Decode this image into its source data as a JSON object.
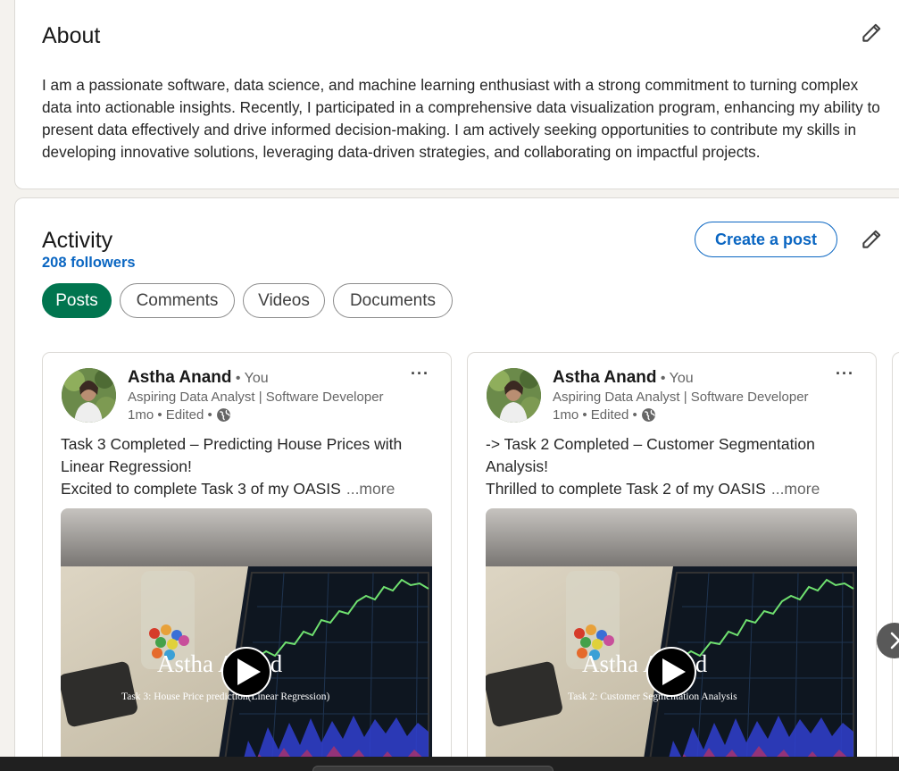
{
  "about": {
    "title": "About",
    "text": "I am a passionate software, data science, and machine learning enthusiast with a strong commitment to turning complex data into actionable insights. Recently, I participated in a comprehensive data visualization program, enhancing my ability to present data effectively and drive informed decision-making. I am actively seeking opportunities to contribute my skills in developing innovative solutions, leveraging data-driven strategies, and collaborating on impactful projects."
  },
  "activity": {
    "title": "Activity",
    "followers": "208 followers",
    "create_post_label": "Create a post",
    "tabs": [
      {
        "label": "Posts",
        "active": true
      },
      {
        "label": "Comments",
        "active": false
      },
      {
        "label": "Videos",
        "active": false
      },
      {
        "label": "Documents",
        "active": false
      }
    ],
    "posts": [
      {
        "author": "Astha Anand",
        "you": "• You",
        "headline": "Aspiring Data Analyst | Software Developer",
        "meta": "1mo • Edited •",
        "more_menu": "···",
        "line1": "Task 3 Completed – Predicting House Prices with Linear Regression!",
        "line2": "Excited to complete Task 3 of my OASIS",
        "see_more": "...more",
        "video_title": "Astha Anand",
        "video_subtitle": "Task 3: House Price prediction(Linear Regression)"
      },
      {
        "author": "Astha Anand",
        "you": "• You",
        "headline": "Aspiring Data Analyst | Software Developer",
        "meta": "1mo • Edited •",
        "more_menu": "···",
        "line1": "-> Task 2 Completed – Customer Segmentation Analysis!",
        "line2": "Thrilled to complete Task 2 of my OASIS",
        "see_more": "...more",
        "video_title": "Astha Anand",
        "video_subtitle": "Task 2: Customer Segmentation Analysis"
      }
    ],
    "next_arrow": "›"
  },
  "icons": {
    "edit": "pencil-icon",
    "globe": "globe-icon",
    "play": "play-icon",
    "chevron": "chevron-right-icon"
  },
  "colors": {
    "accent": "#0a66c2",
    "active_tab": "#01754f"
  }
}
